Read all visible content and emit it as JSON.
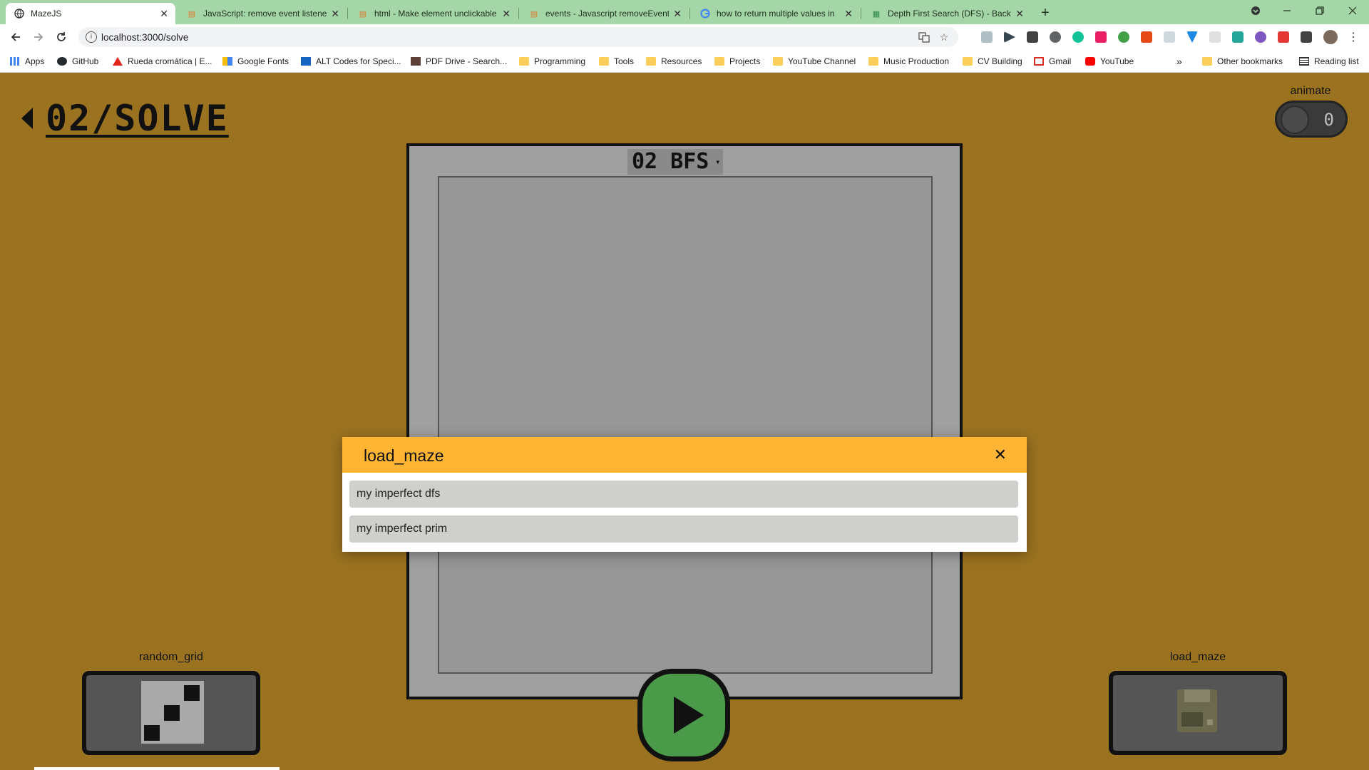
{
  "browser": {
    "tabs": [
      {
        "title": "MazeJS",
        "close": "✕"
      },
      {
        "title": "JavaScript: remove event listener",
        "close": "✕"
      },
      {
        "title": "html - Make element unclickable",
        "close": "✕"
      },
      {
        "title": "events - Javascript removeEventL",
        "close": "✕"
      },
      {
        "title": "how to return multiple values in",
        "close": "✕"
      },
      {
        "title": "Depth First Search (DFS) - Backtr",
        "close": "✕"
      }
    ],
    "new_tab": "+",
    "url": "localhost:3000/solve",
    "bookmarks": [
      {
        "label": "Apps",
        "icon": "apps-grid-icon"
      },
      {
        "label": "GitHub",
        "icon": "github-icon"
      },
      {
        "label": "Rueda cromática | E...",
        "icon": "adobe-icon"
      },
      {
        "label": "Google Fonts",
        "icon": "google-fonts-icon"
      },
      {
        "label": "ALT Codes for Speci...",
        "icon": "alt-codes-icon"
      },
      {
        "label": "PDF Drive - Search...",
        "icon": "pdf-drive-icon"
      },
      {
        "label": "Programming",
        "icon": "folder-icon"
      },
      {
        "label": "Tools",
        "icon": "folder-icon"
      },
      {
        "label": "Resources",
        "icon": "folder-icon"
      },
      {
        "label": "Projects",
        "icon": "folder-icon"
      },
      {
        "label": "YouTube Channel",
        "icon": "folder-icon"
      },
      {
        "label": "Music Production",
        "icon": "folder-icon"
      },
      {
        "label": "CV Building",
        "icon": "folder-icon"
      },
      {
        "label": "Gmail",
        "icon": "gmail-icon"
      },
      {
        "label": "YouTube",
        "icon": "youtube-icon"
      }
    ],
    "overflow": "»",
    "other_bookmarks": "Other bookmarks",
    "reading_list": "Reading list"
  },
  "page": {
    "title": "02/SOLVE",
    "animate_label": "animate",
    "animate_state": "0",
    "algorithm": "02 BFS",
    "caret": "▾",
    "controls": {
      "random_grid_label": "random_grid",
      "load_maze_label": "load_maze"
    }
  },
  "modal": {
    "title": "load_maze",
    "close": "✕",
    "items": [
      "my imperfect dfs",
      "my imperfect prim"
    ]
  },
  "colors": {
    "page_bg": "#9b7220",
    "modal_header": "#ffb533",
    "play_button": "#4a9a4a",
    "tab_strip": "#a5d6a7"
  }
}
